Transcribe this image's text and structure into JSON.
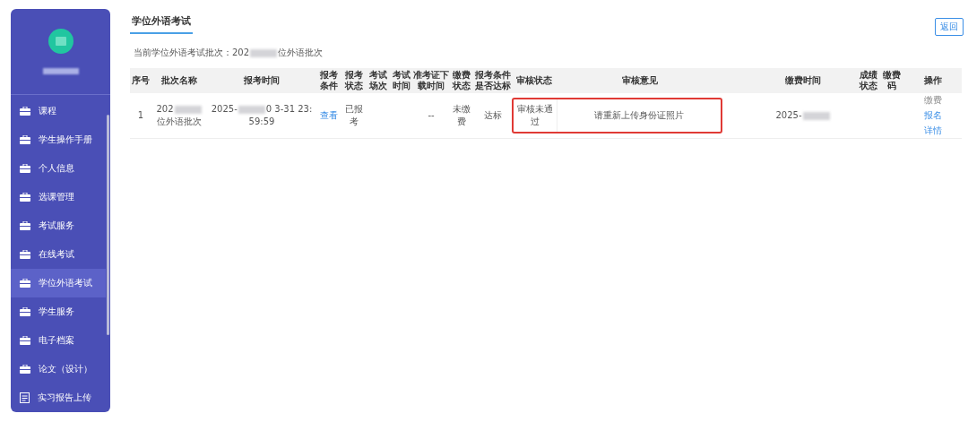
{
  "sidebar": {
    "items": [
      {
        "label": "课程",
        "selected": false,
        "kind": "briefcase"
      },
      {
        "label": "学生操作手册",
        "selected": false,
        "kind": "briefcase"
      },
      {
        "label": "个人信息",
        "selected": false,
        "kind": "briefcase"
      },
      {
        "label": "选课管理",
        "selected": false,
        "kind": "briefcase"
      },
      {
        "label": "考试服务",
        "selected": false,
        "kind": "briefcase"
      },
      {
        "label": "在线考试",
        "selected": false,
        "kind": "briefcase"
      },
      {
        "label": "学位外语考试",
        "selected": true,
        "kind": "briefcase"
      },
      {
        "label": "学生服务",
        "selected": false,
        "kind": "briefcase"
      },
      {
        "label": "电子档案",
        "selected": false,
        "kind": "briefcase"
      },
      {
        "label": "论文（设计）",
        "selected": false,
        "kind": "briefcase"
      },
      {
        "label": "实习报告上传",
        "selected": false,
        "kind": "document"
      }
    ]
  },
  "page": {
    "title": "学位外语考试",
    "back_button": "返回",
    "batch_line": [
      {
        "kind": "text",
        "text": "当前学位外语考试批次：202"
      },
      {
        "kind": "blur"
      },
      {
        "kind": "text",
        "text": "位外语批次"
      }
    ]
  },
  "table": {
    "columns": [
      "序号",
      "批次名称",
      "报考时间",
      "报考条件",
      "报考状态",
      "考试场次",
      "考试时间",
      "准考证下载时间",
      "缴费状态",
      "报考条件是否达标",
      "审核状态",
      "审核意见",
      "",
      "缴费时间",
      "成绩状态",
      "缴费码",
      "操作"
    ],
    "rows": [
      {
        "index": "1",
        "batch_name": [
          {
            "kind": "text",
            "text": "202"
          },
          {
            "kind": "blur"
          },
          {
            "kind": "text",
            "text": "位外语批次"
          }
        ],
        "apply_time": [
          {
            "kind": "text",
            "text": "2025-"
          },
          {
            "kind": "blur"
          },
          {
            "kind": "text",
            "text": "0 3-31 23:59:59"
          }
        ],
        "condition_link": "查看",
        "apply_status": "已报考",
        "download_time": "--",
        "pay_status": "未缴费",
        "condition_met": "达标",
        "review_status": "审核未通过",
        "review_comment": "请重新上传身份证照片",
        "review_highlighted": true,
        "pay_time": [
          {
            "kind": "text",
            "text": "2025-"
          },
          {
            "kind": "blur"
          }
        ],
        "actions": [
          {
            "label": "缴费",
            "disabled": true
          },
          {
            "label": "报名",
            "disabled": false
          },
          {
            "label": "详情",
            "disabled": false
          }
        ]
      }
    ]
  }
}
